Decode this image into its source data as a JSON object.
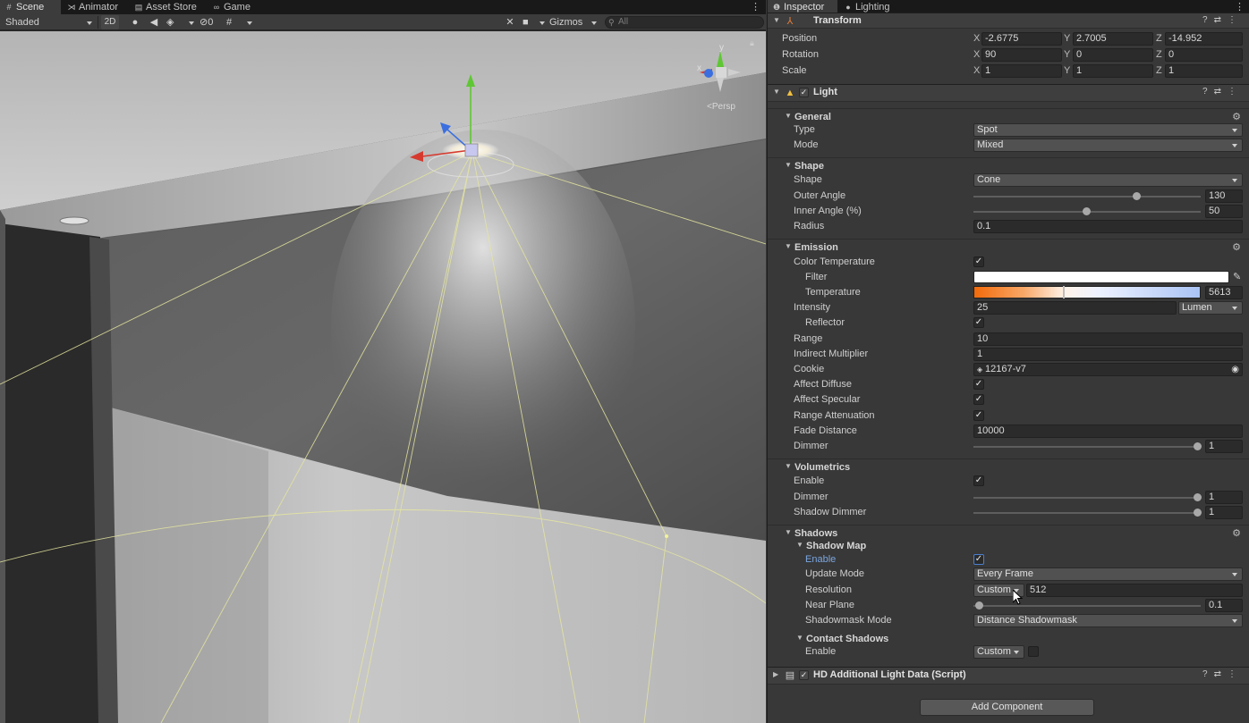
{
  "scene_tabs": [
    {
      "label": "Scene",
      "icon": "scene-grid-icon"
    },
    {
      "label": "Animator",
      "icon": "animator-icon"
    },
    {
      "label": "Asset Store",
      "icon": "store-bag-icon"
    },
    {
      "label": "Game",
      "icon": "game-controller-icon"
    }
  ],
  "scene_toolbar": {
    "draw_mode": "Shaded",
    "toggle_2d": "2D",
    "hidden_count": "0",
    "gizmos": "Gizmos",
    "search_placeholder": "All"
  },
  "viewport": {
    "projection": "Persp",
    "gizmo_axes": {
      "y": "y",
      "x": "x"
    }
  },
  "inspector_tabs": [
    {
      "label": "Inspector",
      "icon": "info-icon"
    },
    {
      "label": "Lighting",
      "icon": "lightbulb-icon"
    }
  ],
  "transform": {
    "title": "Transform",
    "position": {
      "label": "Position",
      "x": "-2.6775",
      "y": "2.7005",
      "z": "-14.952"
    },
    "rotation": {
      "label": "Rotation",
      "x": "90",
      "y": "0",
      "z": "0"
    },
    "scale": {
      "label": "Scale",
      "x": "1",
      "y": "1",
      "z": "1"
    }
  },
  "light": {
    "title": "Light",
    "general": {
      "title": "General",
      "type_label": "Type",
      "type_value": "Spot",
      "mode_label": "Mode",
      "mode_value": "Mixed"
    },
    "shape": {
      "title": "Shape",
      "shape_label": "Shape",
      "shape_value": "Cone",
      "outer_label": "Outer Angle",
      "outer_value": "130",
      "inner_label": "Inner Angle (%)",
      "inner_value": "50",
      "radius_label": "Radius",
      "radius_value": "0.1"
    },
    "emission": {
      "title": "Emission",
      "color_temp_label": "Color Temperature",
      "filter_label": "Filter",
      "temperature_label": "Temperature",
      "temperature_value": "5613",
      "intensity_label": "Intensity",
      "intensity_value": "25",
      "intensity_unit": "Lumen",
      "reflector_label": "Reflector",
      "range_label": "Range",
      "range_value": "10",
      "indirect_label": "Indirect Multiplier",
      "indirect_value": "1",
      "cookie_label": "Cookie",
      "cookie_value": "12167-v7",
      "affect_diffuse_label": "Affect Diffuse",
      "affect_specular_label": "Affect Specular",
      "range_atten_label": "Range Attenuation",
      "fade_label": "Fade Distance",
      "fade_value": "10000",
      "dimmer_label": "Dimmer",
      "dimmer_value": "1"
    },
    "volumetrics": {
      "title": "Volumetrics",
      "enable_label": "Enable",
      "dimmer_label": "Dimmer",
      "dimmer_value": "1",
      "shadow_dimmer_label": "Shadow Dimmer",
      "shadow_dimmer_value": "1"
    },
    "shadows": {
      "title": "Shadows",
      "shadow_map_title": "Shadow Map",
      "enable_label": "Enable",
      "update_label": "Update Mode",
      "update_value": "Every Frame",
      "resolution_label": "Resolution",
      "resolution_mode": "Custom",
      "resolution_value": "512",
      "near_label": "Near Plane",
      "near_value": "0.1",
      "shadowmask_label": "Shadowmask Mode",
      "shadowmask_value": "Distance Shadowmask",
      "contact_title": "Contact Shadows",
      "contact_enable_label": "Enable",
      "contact_enable_value": "Custom"
    }
  },
  "hd_light": {
    "title": "HD Additional Light Data (Script)"
  },
  "add_component_label": "Add Component",
  "colors": {
    "accent_blue": "#7ba6e0",
    "axis_x": "#d63a2f",
    "axis_y": "#5ec733",
    "axis_z": "#3b6fe0"
  }
}
